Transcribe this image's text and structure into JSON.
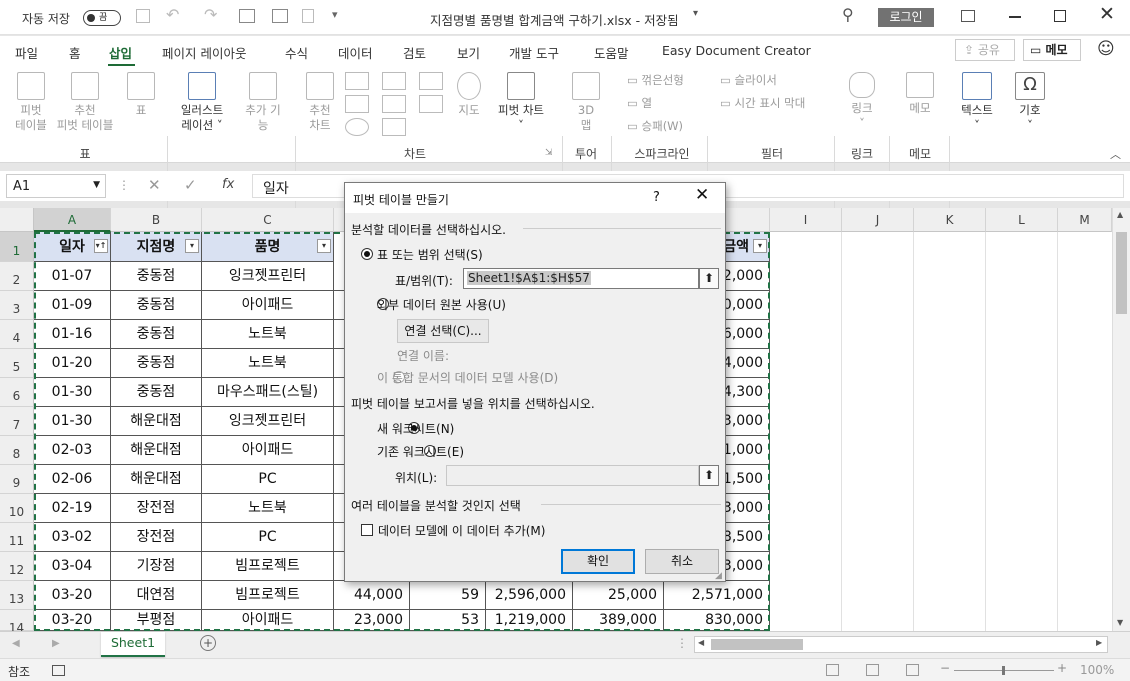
{
  "titlebar": {
    "autosave_label": "자동 저장",
    "autosave_state": "끔",
    "file_title": "지점명별 품명별 합계금액 구하기.xlsx - 저장됨",
    "login_label": "로그인"
  },
  "menu": {
    "tabs": [
      "파일",
      "홈",
      "삽입",
      "페이지 레이아웃",
      "수식",
      "데이터",
      "검토",
      "보기",
      "개발 도구",
      "도움말",
      "Easy Document Creator"
    ],
    "share_label": "공유",
    "memo_label": "메모"
  },
  "ribbon": {
    "pivot_table": [
      "피벗",
      "테이블"
    ],
    "recommended_pivot": [
      "추천",
      "피벗 테이블"
    ],
    "table": "표",
    "illustrations": [
      "일러스트",
      "레이션"
    ],
    "addins": [
      "추가 기",
      "능"
    ],
    "recommended_chart": [
      "추천",
      "차트"
    ],
    "maps": "지도",
    "pivot_chart": "피벗 차트",
    "map3d": [
      "3D",
      "맵"
    ],
    "spark_line": "꺾은선형",
    "spark_column": "열",
    "spark_winloss": "승패(W)",
    "slicer": "슬라이서",
    "timeline": "시간 표시 막대",
    "link": "링크",
    "memo": "메모",
    "text": "텍스트",
    "symbol": "기호",
    "groups": {
      "tables": "표",
      "charts": "차트",
      "tour": "투어",
      "sparklines": "스파크라인",
      "filters": "필터",
      "links": "링크",
      "comments": "메모"
    }
  },
  "formula_bar": {
    "name_box": "A1",
    "fx": "fx",
    "formula": "일자"
  },
  "columns": [
    "A",
    "B",
    "C",
    "I",
    "J",
    "K",
    "L",
    "M"
  ],
  "rows": [
    "1",
    "2",
    "3",
    "4",
    "5",
    "6",
    "7",
    "8",
    "9",
    "10",
    "11",
    "12",
    "13",
    "14"
  ],
  "table": {
    "headers": [
      "일자",
      "지점명",
      "품명"
    ],
    "last_header": "금액",
    "data": [
      [
        "01-07",
        "중동점",
        "잉크젯프린터",
        "2,000"
      ],
      [
        "01-09",
        "중동점",
        "아이패드",
        "0,000"
      ],
      [
        "01-16",
        "중동점",
        "노트북",
        "6,000"
      ],
      [
        "01-20",
        "중동점",
        "노트북",
        "4,000"
      ],
      [
        "01-30",
        "중동점",
        "마우스패드(스틸)",
        "4,300"
      ],
      [
        "01-30",
        "해운대점",
        "잉크젯프린터",
        "3,000"
      ],
      [
        "02-03",
        "해운대점",
        "아이패드",
        "1,000"
      ],
      [
        "02-06",
        "해운대점",
        "PC",
        "1,500"
      ],
      [
        "02-19",
        "장전점",
        "노트북",
        "3,000"
      ],
      [
        "03-02",
        "장전점",
        "PC",
        "8,500"
      ],
      [
        "03-04",
        "기장점",
        "빔프로젝트",
        "3,000"
      ]
    ],
    "row13": [
      "03-20",
      "대연점",
      "빔프로젝트",
      "44,000",
      "59",
      "2,596,000",
      "25,000",
      "2,571,000"
    ],
    "row14": [
      "03-20",
      "부평점",
      "아이패드",
      "23,000",
      "53",
      "1,219,000",
      "389,000",
      "830,000"
    ]
  },
  "dialog": {
    "title": "피벗 테이블 만들기",
    "help": "?",
    "section1": "분석할 데이터를 선택하십시오.",
    "opt_range": "표 또는 범위 선택(S)",
    "range_label": "표/범위(T):",
    "range_value": "Sheet1!$A$1:$H$57",
    "opt_external": "외부 데이터 원본 사용(U)",
    "choose_conn": "연결 선택(C)...",
    "conn_name": "연결 이름:",
    "opt_model": "이 통합 문서의 데이터 모델 사용(D)",
    "section2": "피벗 테이블 보고서를 넣을 위치를 선택하십시오.",
    "opt_new": "새 워크시트(N)",
    "opt_existing": "기존 워크시트(E)",
    "location_label": "위치(L):",
    "section3": "여러 테이블을 분석할 것인지 선택",
    "add_model": "데이터 모델에 이 데이터 추가(M)",
    "ok": "확인",
    "cancel": "취소"
  },
  "sheet_tab": "Sheet1",
  "status": {
    "mode": "참조",
    "zoom": "100%"
  }
}
